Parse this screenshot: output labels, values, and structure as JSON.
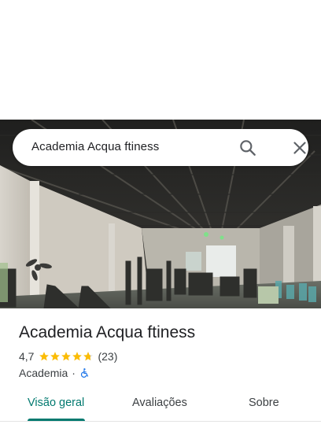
{
  "search": {
    "query": "Academia Acqua ftiness"
  },
  "place": {
    "name": "Academia Acqua ftiness",
    "rating_value": "4,7",
    "rating_stars": 4.7,
    "review_count": "(23)",
    "category": "Academia",
    "separator": "·",
    "accessibility_icon": "wheelchair-accessible-icon"
  },
  "tabs": [
    {
      "label": "Visão geral",
      "active": true
    },
    {
      "label": "Avaliações",
      "active": false
    },
    {
      "label": "Sobre",
      "active": false
    }
  ],
  "colors": {
    "accent": "#01796f",
    "star": "#fbbc04",
    "accessibility": "#1a73e8"
  },
  "icons": {
    "search": "search-icon",
    "close": "close-icon"
  }
}
